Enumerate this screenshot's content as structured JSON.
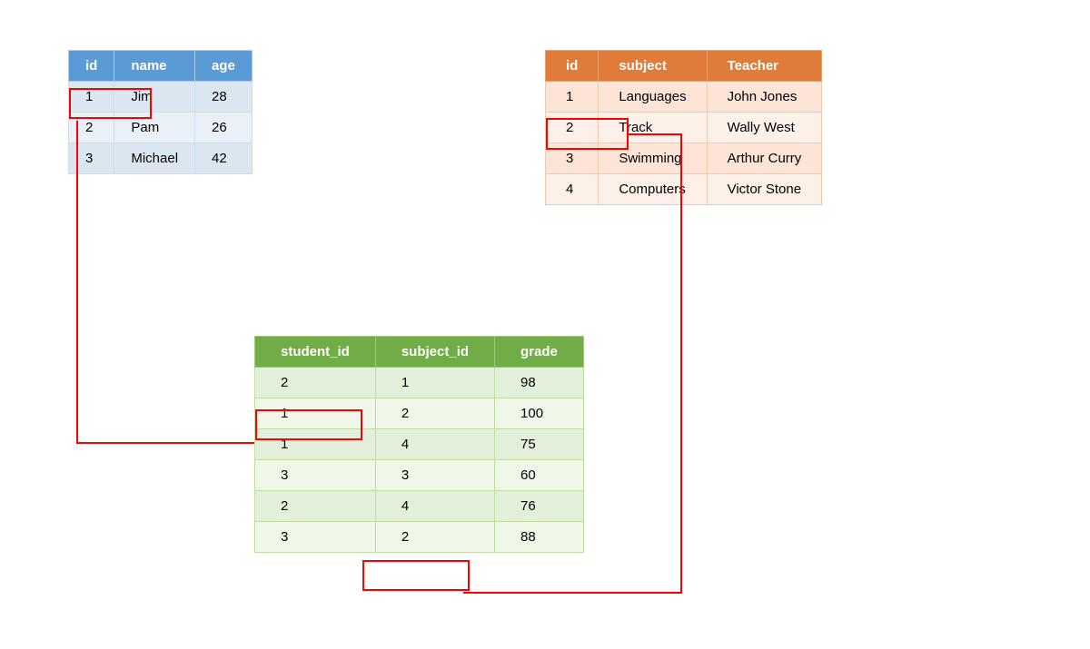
{
  "students": {
    "headers": [
      "id",
      "name",
      "age"
    ],
    "rows": [
      {
        "id": "1",
        "name": "Jim",
        "age": "28"
      },
      {
        "id": "2",
        "name": "Pam",
        "age": "26"
      },
      {
        "id": "3",
        "name": "Michael",
        "age": "42"
      }
    ]
  },
  "courses": {
    "headers": [
      "id",
      "subject",
      "Teacher"
    ],
    "rows": [
      {
        "id": "1",
        "subject": "Languages",
        "teacher": "John Jones"
      },
      {
        "id": "2",
        "subject": "Track",
        "teacher": "Wally West"
      },
      {
        "id": "3",
        "subject": "Swimming",
        "teacher": "Arthur Curry"
      },
      {
        "id": "4",
        "subject": "Computers",
        "teacher": "Victor Stone"
      }
    ]
  },
  "grades": {
    "headers": [
      "student_id",
      "subject_id",
      "grade"
    ],
    "rows": [
      {
        "student_id": "2",
        "subject_id": "1",
        "grade": "98"
      },
      {
        "student_id": "1",
        "subject_id": "2",
        "grade": "100"
      },
      {
        "student_id": "1",
        "subject_id": "4",
        "grade": "75"
      },
      {
        "student_id": "3",
        "subject_id": "3",
        "grade": "60"
      },
      {
        "student_id": "2",
        "subject_id": "4",
        "grade": "76"
      },
      {
        "student_id": "3",
        "subject_id": "2",
        "grade": "88"
      }
    ]
  }
}
